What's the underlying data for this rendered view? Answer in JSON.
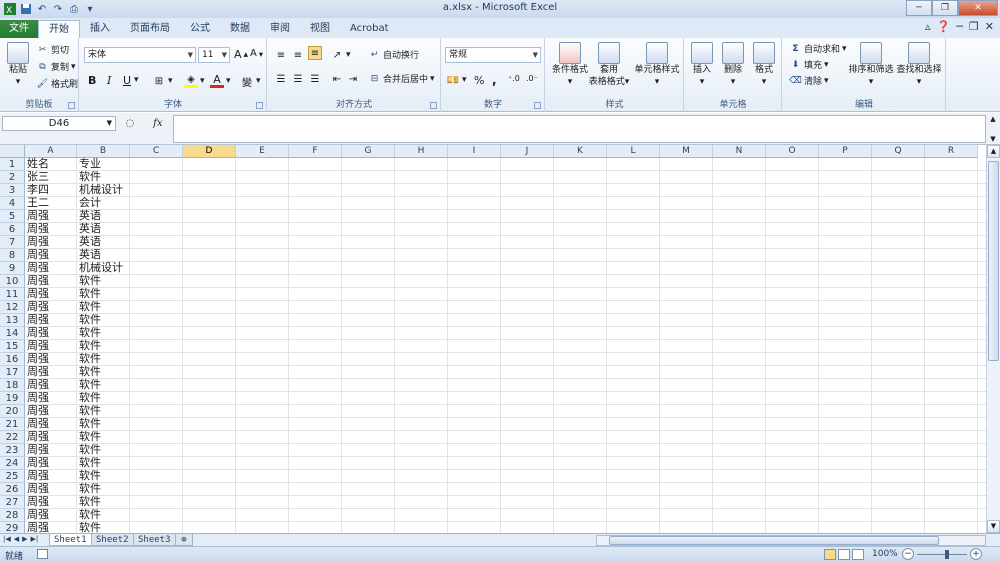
{
  "window": {
    "title": "a.xlsx - Microsoft Excel"
  },
  "qat": {
    "save_icon": "save-icon",
    "undo_icon": "undo-icon",
    "redo_icon": "redo-icon",
    "print_icon": "print-preview-icon"
  },
  "tabs": [
    "文件",
    "开始",
    "插入",
    "页面布局",
    "公式",
    "数据",
    "审阅",
    "视图",
    "Acrobat"
  ],
  "ribbon": {
    "clipboard": {
      "label": "剪贴板",
      "paste": "粘贴",
      "cut": "剪切",
      "copy": "复制",
      "format_painter": "格式刷"
    },
    "font": {
      "label": "字体",
      "font_name": "宋体",
      "font_size": "11",
      "bold": "B",
      "italic": "I",
      "underline": "U",
      "font_color_letter": "A"
    },
    "alignment": {
      "label": "对齐方式",
      "wrap_text": "自动换行",
      "merge_center": "合并后居中"
    },
    "number": {
      "label": "数字",
      "format": "常规",
      "percent": "%",
      "comma": ","
    },
    "styles": {
      "label": "样式",
      "conditional": "条件格式",
      "table_format_1": "套用",
      "table_format_2": "表格格式",
      "cell_styles": "单元格样式"
    },
    "cells": {
      "label": "单元格",
      "insert": "插入",
      "delete": "删除",
      "format": "格式"
    },
    "editing": {
      "label": "编辑",
      "autosum": "自动求和",
      "fill": "填充",
      "clear": "清除",
      "sort_filter": "排序和筛选",
      "find_select": "查找和选择"
    }
  },
  "formula_bar": {
    "name_box": "D46",
    "fx": "fx",
    "value": ""
  },
  "grid": {
    "columns": [
      "A",
      "B",
      "C",
      "D",
      "E",
      "F",
      "G",
      "H",
      "I",
      "J",
      "K",
      "L",
      "M",
      "N",
      "O",
      "P",
      "Q",
      "R"
    ],
    "selected_column": "D",
    "rows": [
      {
        "n": "1",
        "a": "姓名",
        "b": "专业"
      },
      {
        "n": "2",
        "a": "张三",
        "b": "软件"
      },
      {
        "n": "3",
        "a": "李四",
        "b": "机械设计"
      },
      {
        "n": "4",
        "a": "王二",
        "b": "会计"
      },
      {
        "n": "5",
        "a": "周强",
        "b": "英语"
      },
      {
        "n": "6",
        "a": "周强",
        "b": "英语"
      },
      {
        "n": "7",
        "a": "周强",
        "b": "英语"
      },
      {
        "n": "8",
        "a": "周强",
        "b": "英语"
      },
      {
        "n": "9",
        "a": "周强",
        "b": "机械设计"
      },
      {
        "n": "10",
        "a": "周强",
        "b": "软件"
      },
      {
        "n": "11",
        "a": "周强",
        "b": "软件"
      },
      {
        "n": "12",
        "a": "周强",
        "b": "软件"
      },
      {
        "n": "13",
        "a": "周强",
        "b": "软件"
      },
      {
        "n": "14",
        "a": "周强",
        "b": "软件"
      },
      {
        "n": "15",
        "a": "周强",
        "b": "软件"
      },
      {
        "n": "16",
        "a": "周强",
        "b": "软件"
      },
      {
        "n": "17",
        "a": "周强",
        "b": "软件"
      },
      {
        "n": "18",
        "a": "周强",
        "b": "软件"
      },
      {
        "n": "19",
        "a": "周强",
        "b": "软件"
      },
      {
        "n": "20",
        "a": "周强",
        "b": "软件"
      },
      {
        "n": "21",
        "a": "周强",
        "b": "软件"
      },
      {
        "n": "22",
        "a": "周强",
        "b": "软件"
      },
      {
        "n": "23",
        "a": "周强",
        "b": "软件"
      },
      {
        "n": "24",
        "a": "周强",
        "b": "软件"
      },
      {
        "n": "25",
        "a": "周强",
        "b": "软件"
      },
      {
        "n": "26",
        "a": "周强",
        "b": "软件"
      },
      {
        "n": "27",
        "a": "周强",
        "b": "软件"
      },
      {
        "n": "28",
        "a": "周强",
        "b": "软件"
      },
      {
        "n": "29",
        "a": "周强",
        "b": "软件"
      }
    ]
  },
  "sheets": [
    {
      "name": "Sheet1",
      "active": true
    },
    {
      "name": "Sheet2",
      "active": false
    },
    {
      "name": "Sheet3",
      "active": false
    }
  ],
  "status": {
    "ready": "就绪",
    "zoom": "100%"
  },
  "colors": {
    "file_tab": "#227d2e",
    "selected_header": "#f9d98b",
    "ribbon_bg": "#e5edf7"
  }
}
